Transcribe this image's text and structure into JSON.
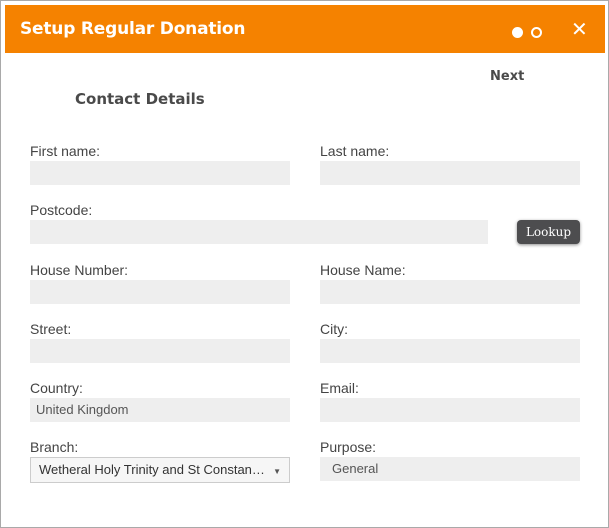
{
  "dialog": {
    "title": "Setup Regular Donation",
    "steps": {
      "current": 1,
      "total": 2
    },
    "close_label": "✕",
    "next_label": "Next",
    "section_title": "Contact Details",
    "accent_color": "#f58200"
  },
  "form": {
    "first_name": {
      "label": "First name:",
      "value": ""
    },
    "last_name": {
      "label": "Last name:",
      "value": ""
    },
    "postcode": {
      "label": "Postcode:",
      "value": ""
    },
    "lookup_label": "Lookup",
    "house_number": {
      "label": "House Number:",
      "value": ""
    },
    "house_name": {
      "label": "House Name:",
      "value": ""
    },
    "street": {
      "label": "Street:",
      "value": ""
    },
    "city": {
      "label": "City:",
      "value": ""
    },
    "country": {
      "label": "Country:",
      "value": "United Kingdom"
    },
    "email": {
      "label": "Email:",
      "value": ""
    },
    "branch": {
      "label": "Branch:",
      "selected": "Wetheral Holy Trinity and St Constantine"
    },
    "purpose": {
      "label": "Purpose:",
      "value": "General"
    }
  }
}
